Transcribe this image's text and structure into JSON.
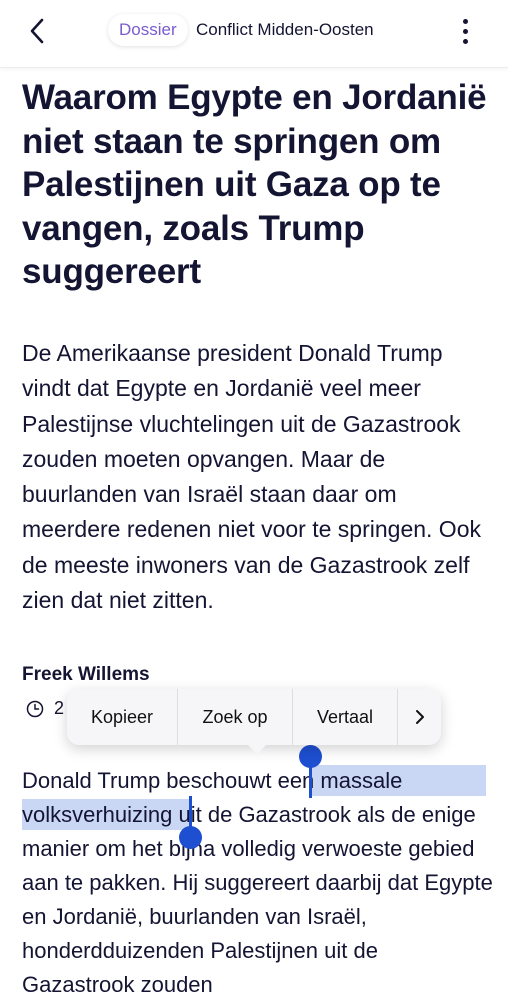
{
  "topbar": {
    "back_icon": "chevron-left-icon",
    "dossier_label": "Dossier",
    "dossier_title": "Conflict Midden-Oosten",
    "more_icon": "more-vertical-icon"
  },
  "article": {
    "headline": "Waarom Egypte en Jordanië niet staan te springen om Palestijnen uit Gaza op te vangen, zoals Trump suggereert",
    "lead": "De Amerikaanse president Donald Trump vindt dat Egypte en Jordanië veel meer Palestijnse vluchtelingen uit de Gazastrook zouden moeten opvangen. Maar de buurlanden van Israël staan daar om meerdere redenen niet voor te springen. Ook de meeste inwoners van de Gazastrook zelf zien dat niet zitten.",
    "author": "Freek Willems",
    "meta_partial": "2",
    "clock_icon": "clock-icon",
    "body_before": "Donald Trump beschouwt ",
    "body_selected": "een massale volksverhuizing",
    "body_after": " uit de Gazastrook als de enige manier om het bijna volledig verwoeste gebied aan te pakken. Hij suggereert daarbij dat Egypte en Jordanië, buurlanden van Israël, honderdduizenden Palestijnen uit de Gazastrook zouden"
  },
  "context_menu": {
    "items": [
      "Kopieer",
      "Zoek op",
      "Vertaal"
    ],
    "more_icon": "chevron-right-icon"
  },
  "colors": {
    "text": "#141433",
    "dossier_accent": "#7a5ccf",
    "selection": "#c9d7f4",
    "selection_handle": "#1f4fd1"
  }
}
